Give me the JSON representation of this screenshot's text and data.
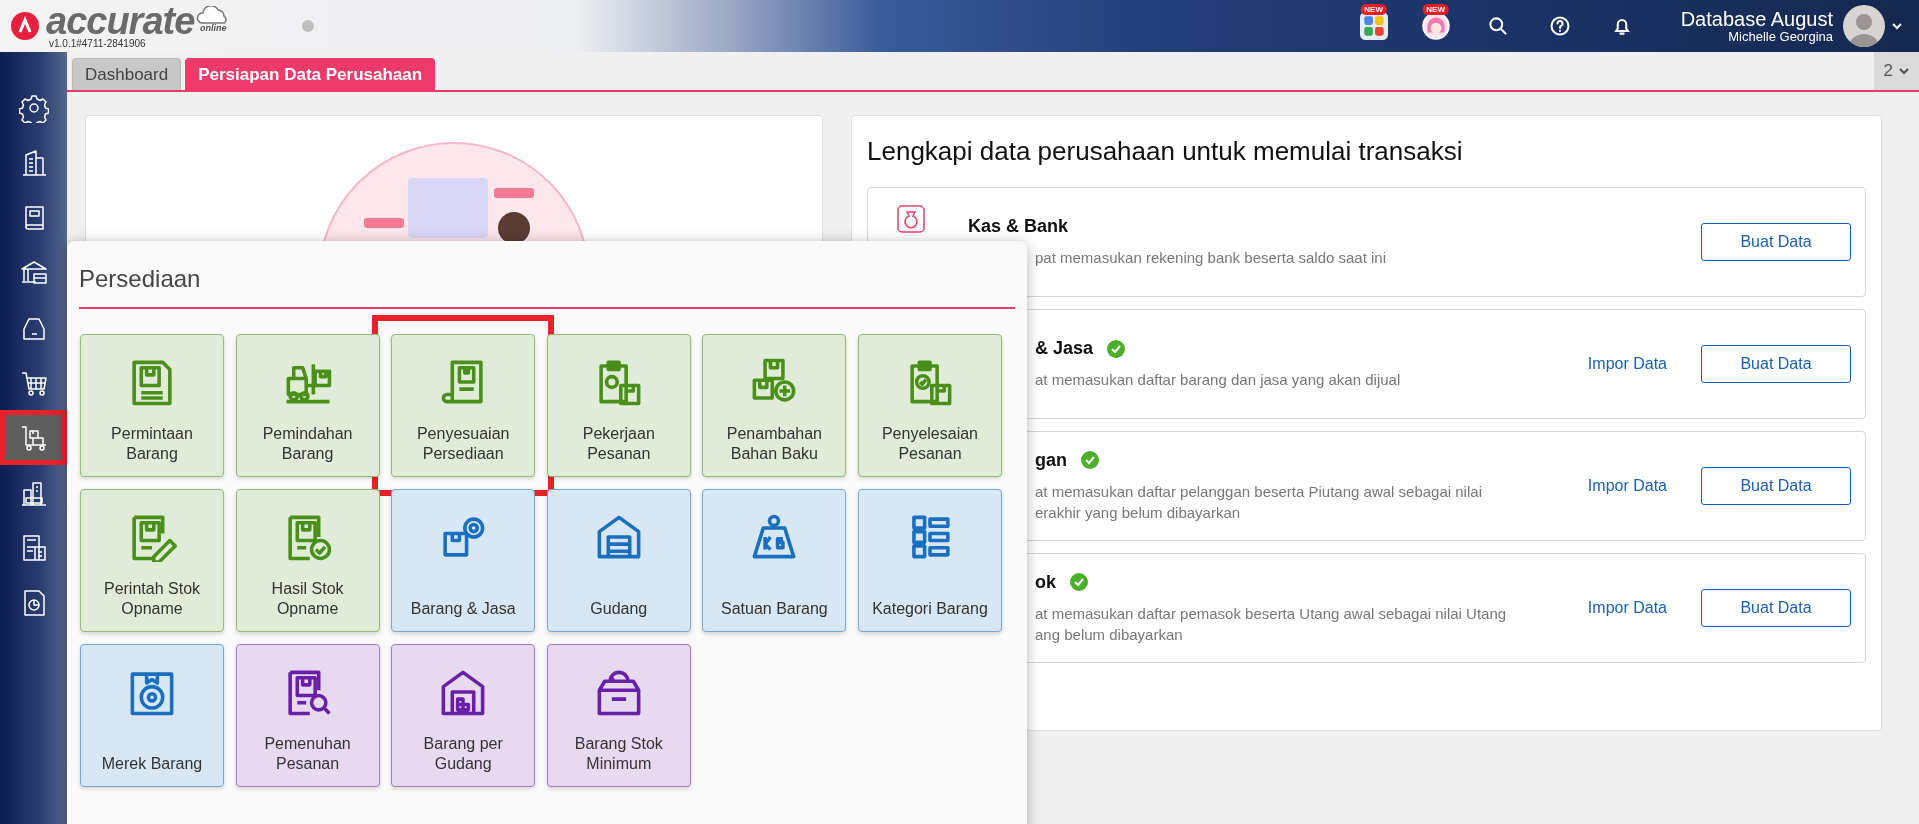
{
  "header": {
    "logo_text": "accurate",
    "logo_sub": "online",
    "version": "v1.0.1#4711-2841906",
    "tools": [
      {
        "kind": "apps",
        "badge": "NEW"
      },
      {
        "kind": "mascot",
        "badge": "NEW"
      },
      {
        "kind": "search"
      },
      {
        "kind": "help"
      },
      {
        "kind": "bell"
      }
    ],
    "database": "Database August",
    "user": "Michelle Georgina"
  },
  "tabs": [
    {
      "label": "Dashboard",
      "selected": false
    },
    {
      "label": "Persiapan Data Perusahaan",
      "selected": true
    }
  ],
  "tab_count": "2",
  "sidebar": {
    "items": [
      {
        "kind": "settings",
        "selected": false
      },
      {
        "kind": "company",
        "selected": false
      },
      {
        "kind": "book",
        "selected": false
      },
      {
        "kind": "bank",
        "selected": false
      },
      {
        "kind": "tag",
        "selected": false
      },
      {
        "kind": "cart",
        "selected": false
      },
      {
        "kind": "trolley",
        "selected": true
      },
      {
        "kind": "city",
        "selected": false
      },
      {
        "kind": "tax",
        "selected": false
      },
      {
        "kind": "report",
        "selected": false
      }
    ]
  },
  "setup_panel": {
    "title": "Lengkapi data perusahaan untuk memulai transaksi",
    "items": [
      {
        "kind": "cash",
        "title": "Kas & Bank",
        "done": false,
        "description": [
          "pat memasukan rekening bank beserta saldo saat ini"
        ],
        "button": "Buat Data"
      },
      {
        "title": "& Jasa",
        "done": true,
        "description": [
          "at memasukan daftar barang dan jasa yang akan dijual"
        ],
        "link": "Impor Data",
        "button": "Buat Data"
      },
      {
        "title": "gan",
        "done": true,
        "description": [
          "at memasukan daftar pelanggan beserta Piutang awal sebagai nilai",
          "erakhir yang belum dibayarkan"
        ],
        "link": "Impor Data",
        "button": "Buat Data"
      },
      {
        "title": "ok",
        "done": true,
        "description": [
          "at memasukan daftar pemasok beserta Utang awal sebagai nilai Utang",
          "ang belum dibayarkan"
        ],
        "link": "Impor Data",
        "button": "Buat Data"
      }
    ]
  },
  "popup": {
    "title": "Persediaan",
    "tiles": [
      {
        "label": "Permintaan Barang",
        "kind": "doc",
        "color": "#4a8f1a",
        "highlighted": false
      },
      {
        "label": "Pemindahan Barang",
        "kind": "forklift",
        "color": "#4a8f1a",
        "highlighted": false
      },
      {
        "label": "Penyesuaian Persediaan",
        "kind": "docs",
        "color": "#4a8f1a",
        "highlighted": true
      },
      {
        "label": "Pekerjaan Pesanan",
        "kind": "clip-gear",
        "color": "#4a8f1a",
        "highlighted": false
      },
      {
        "label": "Penambahan Bahan Baku",
        "kind": "boxes-plus",
        "color": "#4a8f1a",
        "highlighted": false
      },
      {
        "label": "Penyelesaian Pesanan",
        "kind": "clip-check",
        "color": "#4a8f1a",
        "highlighted": false
      },
      {
        "label": "Perintah Stok Opname",
        "kind": "doc-pen",
        "color": "#4a8f1a",
        "highlighted": false
      },
      {
        "label": "Hasil Stok Opname",
        "kind": "doc-check",
        "color": "#4a8f1a",
        "highlighted": false
      },
      {
        "label": "Barang & Jasa",
        "kind": "box-gear",
        "color": "#1a6fc0",
        "highlighted": false
      },
      {
        "label": "Gudang",
        "kind": "warehouse",
        "color": "#1a6fc0",
        "highlighted": false
      },
      {
        "label": "Satuan Barang",
        "kind": "weight",
        "color": "#1a6fc0",
        "highlighted": false
      },
      {
        "label": "Kategori Barang",
        "kind": "grid",
        "color": "#1a6fc0",
        "highlighted": false
      },
      {
        "label": "Merek Barang",
        "kind": "badge-box",
        "color": "#1a6fc0",
        "highlighted": false
      },
      {
        "label": "Pemenuhan Pesanan",
        "kind": "doc-search",
        "color": "#6a1fa8",
        "highlighted": false
      },
      {
        "label": "Barang per Gudang",
        "kind": "house-boxes",
        "color": "#6a1fa8",
        "highlighted": false
      },
      {
        "label": "Barang Stok Minimum",
        "kind": "open-box",
        "color": "#6a1fa8",
        "highlighted": false
      }
    ]
  }
}
